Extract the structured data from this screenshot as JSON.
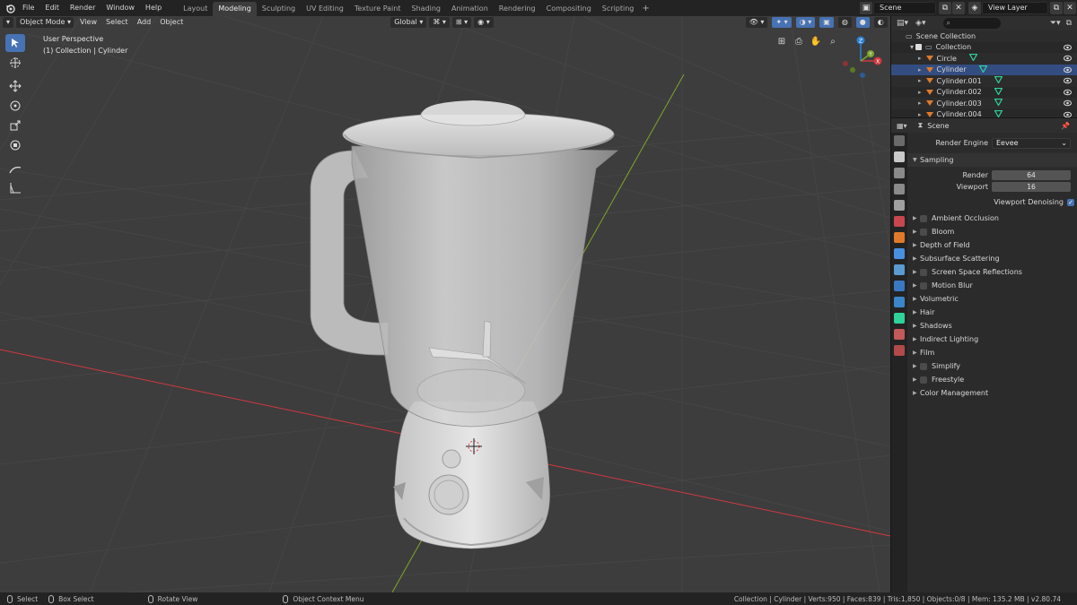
{
  "top_menu": [
    "File",
    "Edit",
    "Render",
    "Window",
    "Help"
  ],
  "workspaces": [
    {
      "label": "Layout",
      "active": false
    },
    {
      "label": "Modeling",
      "active": true
    },
    {
      "label": "Sculpting",
      "active": false
    },
    {
      "label": "UV Editing",
      "active": false
    },
    {
      "label": "Texture Paint",
      "active": false
    },
    {
      "label": "Shading",
      "active": false
    },
    {
      "label": "Animation",
      "active": false
    },
    {
      "label": "Rendering",
      "active": false
    },
    {
      "label": "Compositing",
      "active": false
    },
    {
      "label": "Scripting",
      "active": false
    }
  ],
  "add_workspace_label": "+",
  "scene_field": "Scene",
  "view_layer_field": "View Layer",
  "viewport": {
    "mode": "Object Mode",
    "menus": [
      "View",
      "Select",
      "Add",
      "Object"
    ],
    "transform_orientation": "Global",
    "perspective_label": "User Perspective",
    "collection_label": "(1) Collection | Cylinder",
    "gizmo": {
      "x": "X",
      "y": "Y",
      "z": "Z"
    }
  },
  "outliner": {
    "root": "Scene Collection",
    "collection": "Collection",
    "items": [
      "Circle",
      "Cylinder",
      "Cylinder.001",
      "Cylinder.002",
      "Cylinder.003",
      "Cylinder.004"
    ],
    "selected": "Cylinder"
  },
  "properties": {
    "context": "Scene",
    "render_engine_label": "Render Engine",
    "render_engine": "Eevee",
    "sampling": {
      "title": "Sampling",
      "render_label": "Render",
      "render_value": "64",
      "viewport_label": "Viewport",
      "viewport_value": "16",
      "denoise_label": "Viewport Denoising",
      "denoise": true
    },
    "panels": [
      {
        "label": "Ambient Occlusion",
        "checkbox": true
      },
      {
        "label": "Bloom",
        "checkbox": true
      },
      {
        "label": "Depth of Field",
        "checkbox": false
      },
      {
        "label": "Subsurface Scattering",
        "checkbox": false
      },
      {
        "label": "Screen Space Reflections",
        "checkbox": true
      },
      {
        "label": "Motion Blur",
        "checkbox": true
      },
      {
        "label": "Volumetric",
        "checkbox": false
      },
      {
        "label": "Hair",
        "checkbox": false
      },
      {
        "label": "Shadows",
        "checkbox": false
      },
      {
        "label": "Indirect Lighting",
        "checkbox": false
      },
      {
        "label": "Film",
        "checkbox": false
      },
      {
        "label": "Simplify",
        "checkbox": true
      },
      {
        "label": "Freestyle",
        "checkbox": true
      },
      {
        "label": "Color Management",
        "checkbox": false
      }
    ]
  },
  "statusbar": {
    "select": "Select",
    "box_select": "Box Select",
    "rotate_view": "Rotate View",
    "context_menu": "Object Context Menu",
    "stats": "Collection | Cylinder | Verts:950 | Faces:839 | Tris:1,850 | Objects:0/8 | Mem: 135.2 MB | v2.80.74"
  },
  "colors": {
    "accent": "#4772b3",
    "x_axis": "#d2383e",
    "y_axis": "#7fa52e",
    "z_axis": "#2b82d6",
    "object_orange": "#e07a2a",
    "mesh_green": "#2fd39a"
  }
}
